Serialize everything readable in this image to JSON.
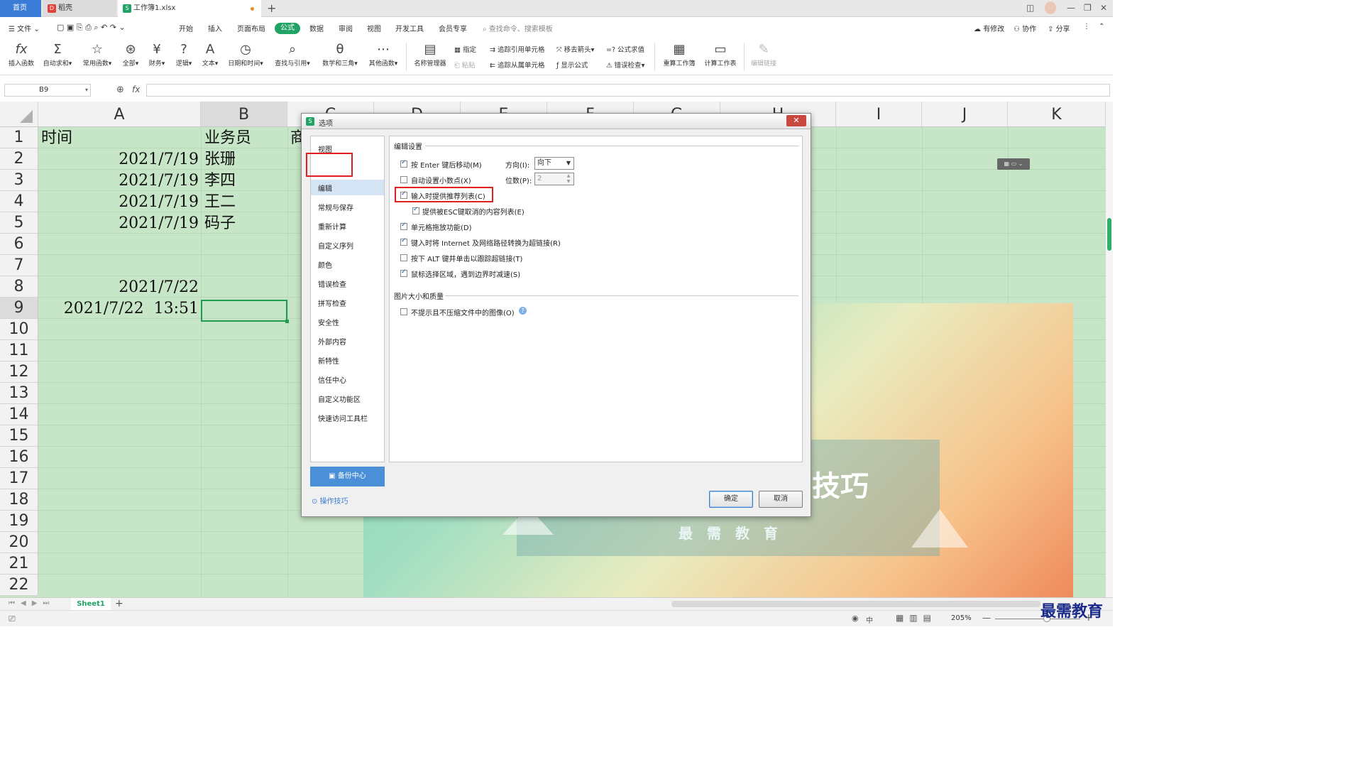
{
  "tabs": {
    "home": "首页",
    "docer": "稻壳",
    "workbook": "工作簿1.xlsx",
    "close": "×",
    "new_tab": "+"
  },
  "menu": {
    "file": "文件",
    "items": [
      "开始",
      "插入",
      "页面布局",
      "公式",
      "数据",
      "审阅",
      "视图",
      "开发工具",
      "会员专享"
    ],
    "active": "公式",
    "search_placeholder": "查找命令、搜索模板",
    "has_changes": "有修改",
    "collab": "协作",
    "share": "分享"
  },
  "ribbon": {
    "insert_fn": "插入函数",
    "autosum": "自动求和",
    "common_fn": "常用函数",
    "all": "全部",
    "finance": "财务",
    "logic": "逻辑",
    "text": "文本",
    "datetime": "日期和时间",
    "lookup": "查找与引用",
    "math": "数学和三角",
    "other_fn": "其他函数",
    "name_mgr": "名称管理器",
    "assign": "指定",
    "paste": "粘贴",
    "trace_precedents": "追踪引用单元格",
    "trace_dependents": "追踪从属单元格",
    "remove_arrows": "移去箭头",
    "show_formula": "显示公式",
    "eval_formula": "公式求值",
    "error_check": "错误检查",
    "recalc_book": "重算工作簿",
    "calc_sheet": "计算工作表",
    "edit_links": "编辑链接"
  },
  "formula_bar": {
    "name_box": "B9",
    "fx": "fx"
  },
  "grid": {
    "columns": [
      "A",
      "B",
      "C",
      "D",
      "E",
      "F",
      "G",
      "H",
      "I",
      "J",
      "K"
    ],
    "rows": [
      "1",
      "2",
      "3",
      "4",
      "5",
      "6",
      "7",
      "8",
      "9",
      "10",
      "11",
      "12",
      "13",
      "14",
      "15",
      "16",
      "17",
      "18",
      "19",
      "20",
      "21",
      "22"
    ],
    "cells": {
      "a1": "时间",
      "b1": "业务员",
      "c1": "商",
      "a2": "2021/7/19",
      "b2": "张珊",
      "a3": "2021/7/19",
      "b3": "李四",
      "a4": "2021/7/19",
      "b4": "王二",
      "a5": "2021/7/19",
      "b5": "码子",
      "a8": "2021/7/22",
      "a9": "2021/7/22  13:51"
    }
  },
  "promo": {
    "title": "技巧",
    "subtitle": "最需教育"
  },
  "sheet": {
    "tab": "Sheet1",
    "add": "+"
  },
  "status": {
    "input_mode": "中",
    "zoom": "205%"
  },
  "dialog": {
    "title": "选项",
    "close": "✕",
    "nav": [
      "视图",
      "编辑",
      "常规与保存",
      "重新计算",
      "自定义序列",
      "颜色",
      "错误检查",
      "拼写检查",
      "安全性",
      "外部内容",
      "新特性",
      "信任中心",
      "自定义功能区",
      "快速访问工具栏"
    ],
    "nav_selected": "编辑",
    "backup": "备份中心",
    "tips": "操作技巧",
    "edit_section": "编辑设置",
    "enter_move": "按 Enter 键后移动(M)",
    "direction_label": "方向(I):",
    "direction_value": "向下",
    "auto_decimal": "自动设置小数点(X)",
    "digits_label": "位数(P):",
    "digits_value": "2",
    "suggest_list": "输入时提供推荐列表(C)",
    "esc_list": "提供被ESC键取消的内容列表(E)",
    "drag_drop": "单元格拖放功能(D)",
    "hyperlink": "键入时将 Internet 及网络路径转换为超链接(R)",
    "alt_click": "按下 ALT 键并单击以跟踪超链接(T)",
    "mouse_slow": "鼠标选择区域，遇到边界时减速(S)",
    "image_section": "图片大小和质量",
    "no_compress": "不提示且不压缩文件中的图像(O)",
    "ok": "确定",
    "cancel": "取消"
  },
  "watermark": "最需教育"
}
